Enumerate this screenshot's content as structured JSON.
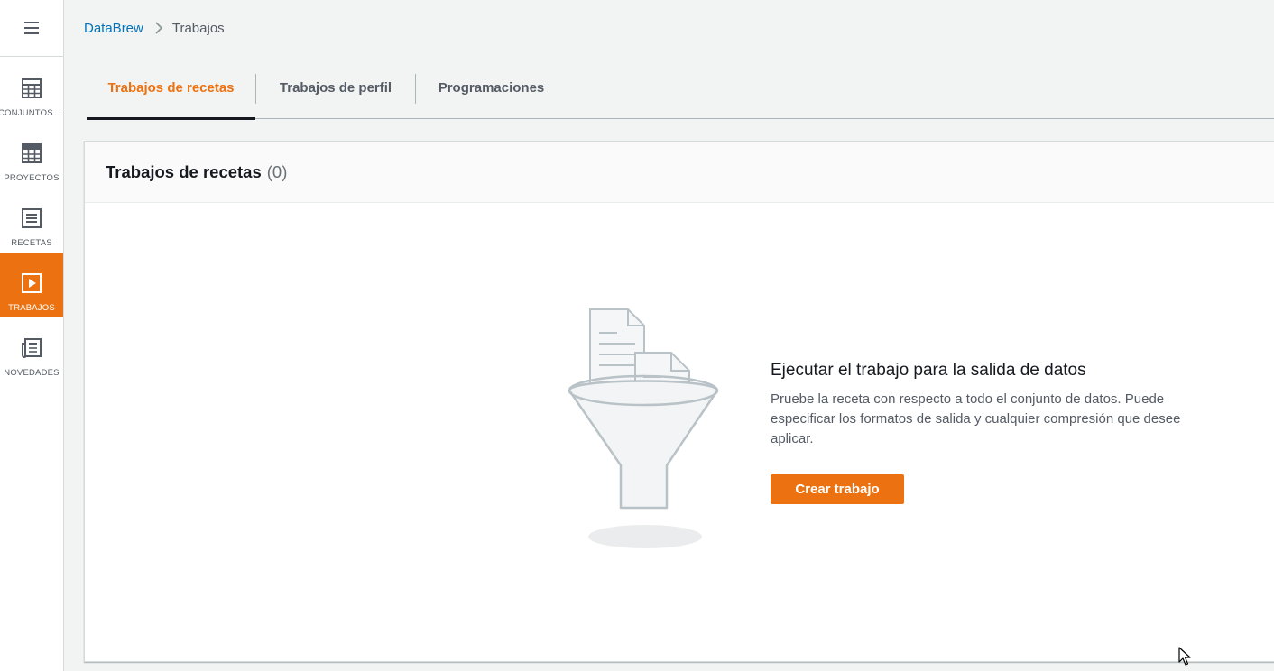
{
  "nav": {
    "items": [
      {
        "label": "CONJUNTOS ...",
        "icon": "table-grid-icon",
        "active": false
      },
      {
        "label": "PROYECTOS",
        "icon": "project-grid-icon",
        "active": false
      },
      {
        "label": "RECETAS",
        "icon": "recipe-list-icon",
        "active": false
      },
      {
        "label": "TRABAJOS",
        "icon": "play-icon",
        "active": true
      },
      {
        "label": "NOVEDADES",
        "icon": "newspaper-icon",
        "active": false
      }
    ]
  },
  "breadcrumb": {
    "root": "DataBrew",
    "current": "Trabajos"
  },
  "tabs": [
    {
      "label": "Trabajos de recetas",
      "active": true
    },
    {
      "label": "Trabajos de perfil",
      "active": false
    },
    {
      "label": "Programaciones",
      "active": false
    }
  ],
  "panel": {
    "title": "Trabajos de recetas",
    "count": "(0)"
  },
  "empty_state": {
    "title": "Ejecutar el trabajo para la salida de datos",
    "description": "Pruebe la receta con respecto a todo el conjunto de datos. Puede especificar los formatos de salida y cualquier compresión que desee aplicar.",
    "button_label": "Crear trabajo"
  },
  "colors": {
    "accent": "#ec7211",
    "link": "#0073bb",
    "text": "#16191f",
    "muted": "#545b64"
  }
}
